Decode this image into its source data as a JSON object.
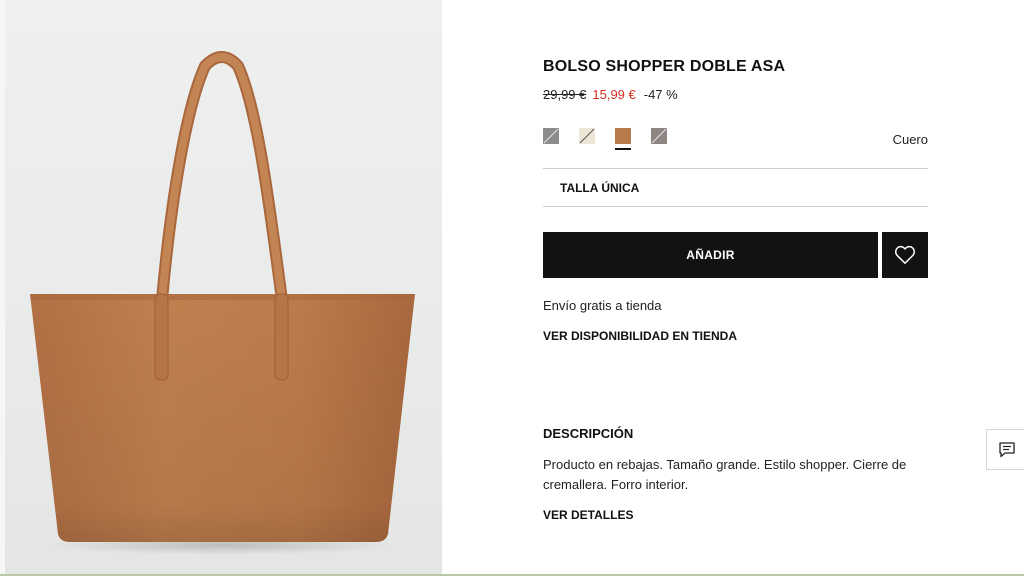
{
  "product": {
    "title": "BOLSO SHOPPER DOBLE ASA",
    "old_price": "29,99 €",
    "new_price": "15,99 €",
    "discount": "-47 %",
    "material": "Cuero",
    "size_label": "TALLA ÚNICA",
    "add_label": "AÑADIR",
    "shipping_text": "Envío gratis a tienda",
    "availability_link": "VER DISPONIBILIDAD EN TIENDA"
  },
  "swatches": [
    {
      "name": "grey",
      "color": "#8c8c8c",
      "selected": false
    },
    {
      "name": "cream",
      "color": "#ece6d6",
      "selected": false
    },
    {
      "name": "leather",
      "color": "#b87a4b",
      "selected": true
    },
    {
      "name": "taupe",
      "color": "#8f8583",
      "selected": false
    }
  ],
  "description": {
    "heading": "DESCRIPCIÓN",
    "text": "Producto en rebajas. Tamaño grande. Estilo shopper. Cierre de cremallera. Forro interior.",
    "details_link": "VER DETALLES"
  },
  "colors": {
    "sale_red": "#d62f22",
    "button_black": "#121212",
    "bag_tan": "#bd7c4d"
  },
  "icons": {
    "favorite": "heart-icon",
    "chat": "chat-icon"
  }
}
